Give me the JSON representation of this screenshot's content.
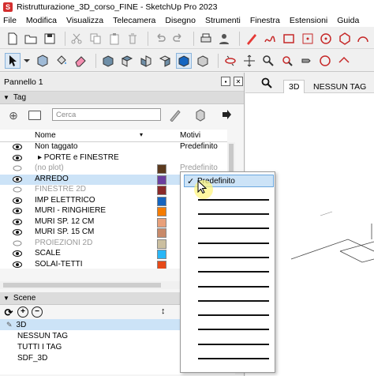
{
  "window": {
    "title": "Ristrutturazione_3D_corso_FINE - SketchUp Pro 2023"
  },
  "menu": [
    "File",
    "Modifica",
    "Visualizza",
    "Telecamera",
    "Disegno",
    "Strumenti",
    "Finestra",
    "Estensioni",
    "Guida"
  ],
  "tray": {
    "title": "Pannello 1",
    "tag_section": "Tag",
    "search_placeholder": "Cerca",
    "col_name": "Nome",
    "col_motivi": "Motivi",
    "scenes_section": "Scene"
  },
  "tags": [
    {
      "name": "Non taggato",
      "motivo": "Predefinito",
      "color": "",
      "visible": true
    },
    {
      "name": "▸ PORTE e FINESTRE",
      "motivo": "",
      "color": "",
      "visible": true
    },
    {
      "name": "(no plot)",
      "motivo": "Predefinito",
      "color": "#5c3a1e",
      "visible": false
    },
    {
      "name": "ARREDO",
      "motivo": "",
      "color": "#6a3fa0",
      "visible": true
    },
    {
      "name": "FINESTRE 2D",
      "motivo": "",
      "color": "#8a2a2a",
      "visible": false
    },
    {
      "name": "IMP ELETTRICO",
      "motivo": "",
      "color": "#1565c0",
      "visible": true
    },
    {
      "name": "MURI - RINGHIERE",
      "motivo": "",
      "color": "#f57c00",
      "visible": true
    },
    {
      "name": "MURI SP. 12 CM",
      "motivo": "",
      "color": "#e8a07a",
      "visible": true
    },
    {
      "name": "MURI SP. 15 CM",
      "motivo": "",
      "color": "#c88a6a",
      "visible": true
    },
    {
      "name": "PROIEZIONI 2D",
      "motivo": "",
      "color": "#cbbfa0",
      "visible": false
    },
    {
      "name": "SCALE",
      "motivo": "",
      "color": "#29b6f6",
      "visible": true
    },
    {
      "name": "SOLAI-TETTI",
      "motivo": "",
      "color": "#e64a19",
      "visible": true
    }
  ],
  "dropdown": {
    "selected": "Predefinito"
  },
  "scenes": [
    "3D",
    "NESSUN TAG",
    "TUTTI I TAG",
    "SDF_3D"
  ],
  "viewport": {
    "tabs": [
      "3D",
      "NESSUN TAG"
    ]
  }
}
